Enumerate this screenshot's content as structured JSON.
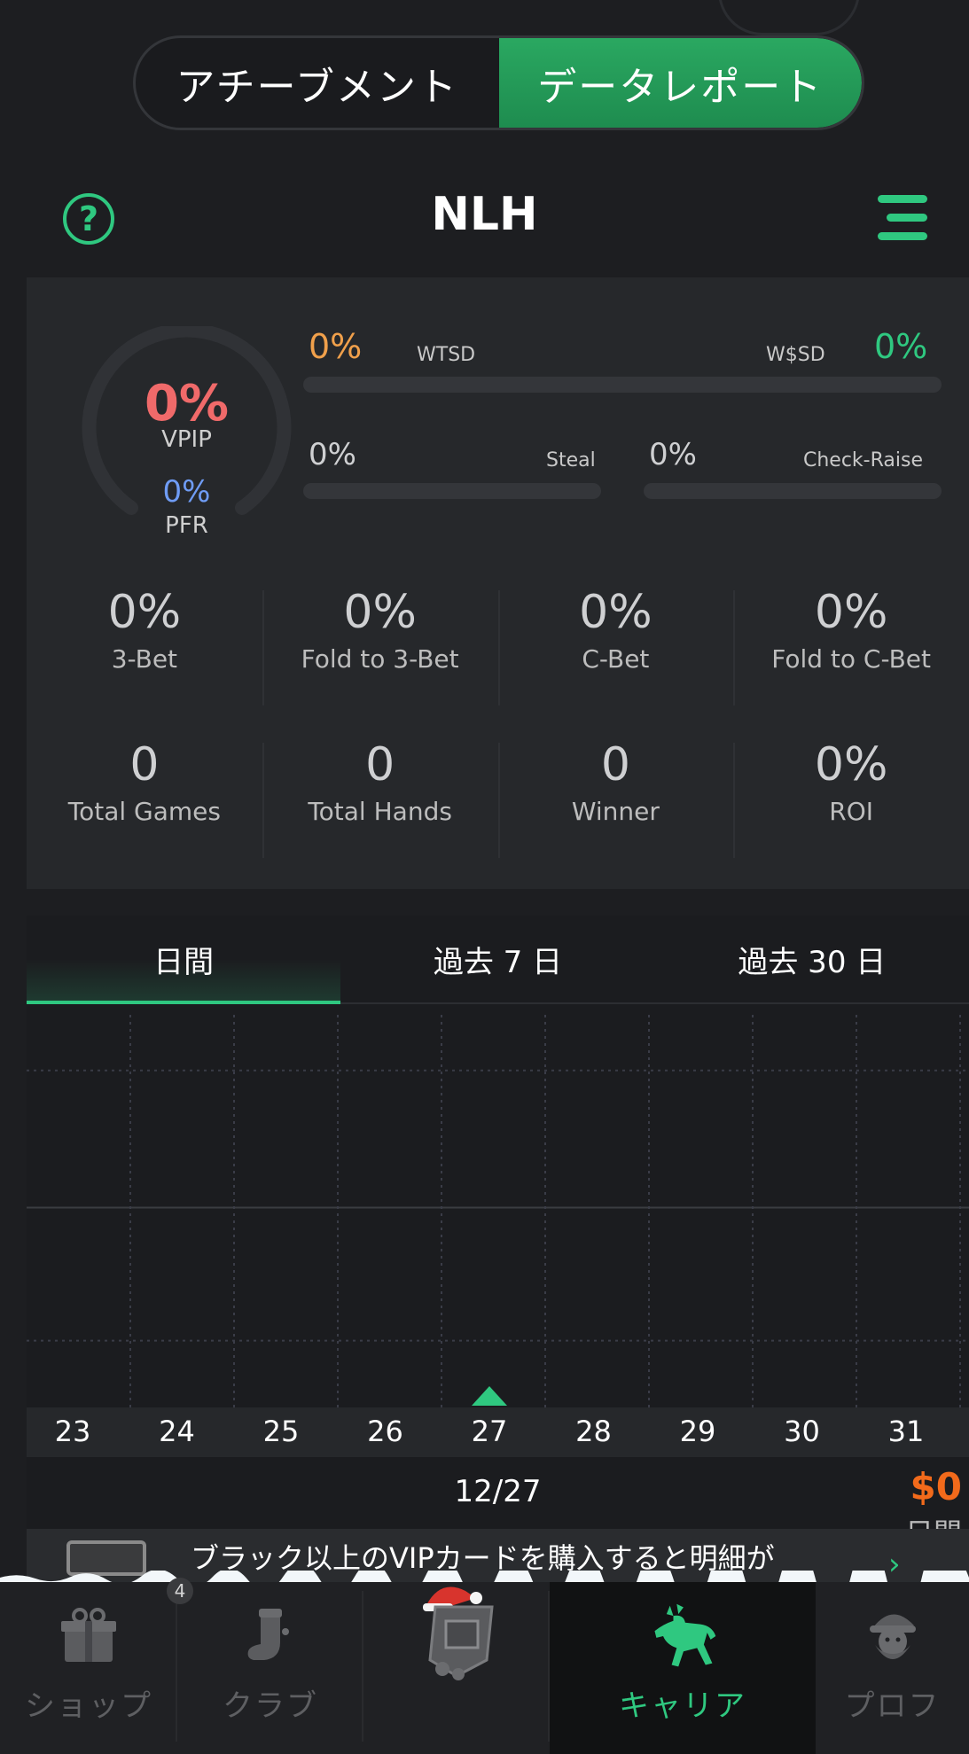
{
  "segment": {
    "tabs": [
      {
        "label": "アチーブメント"
      },
      {
        "label": "データレポート"
      }
    ],
    "active_index": 1
  },
  "header": {
    "title": "NLH",
    "help_icon": "question-circle-icon",
    "menu_icon": "menu-icon"
  },
  "stats": {
    "vpip": {
      "value": "0%",
      "label": "VPIP"
    },
    "pfr": {
      "value": "0%",
      "label": "PFR"
    },
    "wtsd": {
      "value": "0%",
      "label": "WTSD"
    },
    "wssd": {
      "value": "0%",
      "label": "W$SD"
    },
    "steal": {
      "value": "0%",
      "label": "Steal"
    },
    "check_raise": {
      "value": "0%",
      "label": "Check-Raise"
    },
    "row1": [
      {
        "value": "0%",
        "label": "3-Bet"
      },
      {
        "value": "0%",
        "label": "Fold to 3-Bet"
      },
      {
        "value": "0%",
        "label": "C-Bet"
      },
      {
        "value": "0%",
        "label": "Fold to C-Bet"
      }
    ],
    "row2": [
      {
        "value": "0",
        "label": "Total Games"
      },
      {
        "value": "0",
        "label": "Total Hands"
      },
      {
        "value": "0",
        "label": "Winner"
      },
      {
        "value": "0%",
        "label": "ROI"
      }
    ]
  },
  "chart": {
    "tabs": [
      {
        "label": "日間"
      },
      {
        "label": "過去 7 日"
      },
      {
        "label": "過去 30 日"
      }
    ],
    "active_tab": 0,
    "selected_date": "12/27",
    "amount": "$0",
    "amount_label": "日間"
  },
  "chart_data": {
    "type": "line",
    "x": [
      "23",
      "24",
      "25",
      "26",
      "27",
      "28",
      "29",
      "30",
      "31"
    ],
    "series": [
      {
        "values": [
          0,
          0,
          0,
          0,
          0,
          0,
          0,
          0,
          0
        ]
      }
    ],
    "selected": "27",
    "grid": true
  },
  "banner": {
    "text": "ブラック以上のVIPカードを購入すると明細が",
    "icon": "vip-card-icon"
  },
  "nav": {
    "items": [
      {
        "label": "ショップ",
        "icon": "gift-shop-icon"
      },
      {
        "label": "クラブ",
        "icon": "stocking-club-icon",
        "badge": "4"
      },
      {
        "label": "",
        "icon": "christmas-emblem-icon"
      },
      {
        "label": "キャリア",
        "icon": "reindeer-career-icon"
      },
      {
        "label": "プロフ",
        "icon": "santa-profile-icon"
      }
    ],
    "active_index": 3
  },
  "colors": {
    "accent": "#2fc880",
    "vpip": "#f06a6a",
    "pfr": "#6f9cf5",
    "wtsd": "#f0a04b",
    "amount": "#f26a1b"
  }
}
